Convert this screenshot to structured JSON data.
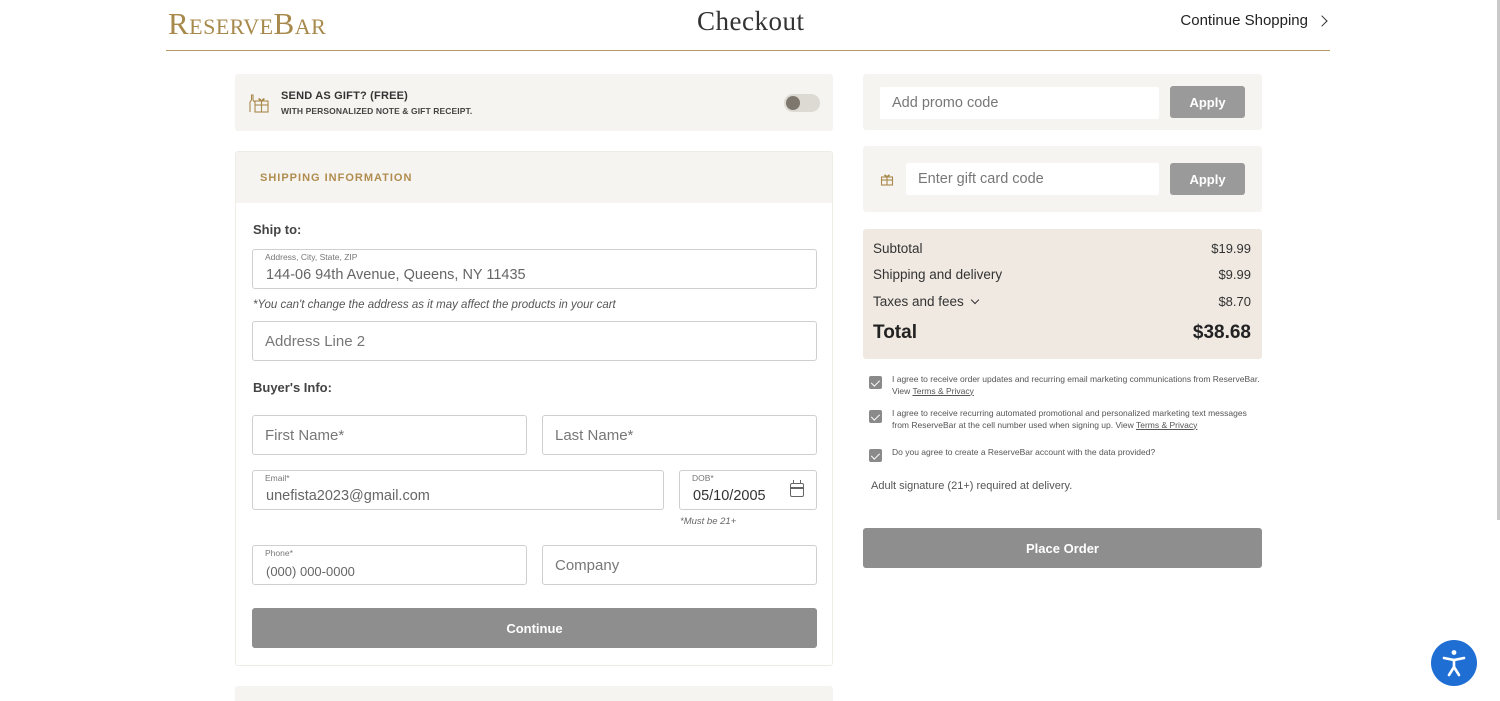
{
  "header": {
    "logo": "ReserveBar",
    "title": "Checkout",
    "continue_shopping": "Continue Shopping"
  },
  "gift": {
    "title": "SEND AS GIFT? (FREE)",
    "subtitle": "WITH PERSONALIZED NOTE & GIFT RECEIPT.",
    "enabled": false
  },
  "shipping": {
    "section_title": "SHIPPING INFORMATION",
    "ship_to_label": "Ship to:",
    "address_label": "Address, City, State, ZIP",
    "address_value": "144-06 94th Avenue, Queens, NY 11435",
    "address_note": "*You can't change the address as it may affect the products in your cart",
    "address2_placeholder": "Address Line 2",
    "buyer_label": "Buyer's Info:",
    "first_name_placeholder": "First Name*",
    "last_name_placeholder": "Last Name*",
    "email_label": "Email*",
    "email_value": "unefista2023@gmail.com",
    "dob_label": "DOB*",
    "dob_value": "05/10/2005",
    "dob_note": "*Must be 21+",
    "phone_label": "Phone*",
    "phone_value": "(000) 000-0000",
    "company_placeholder": "Company",
    "continue_button": "Continue"
  },
  "promo": {
    "placeholder": "Add promo code",
    "apply_label": "Apply"
  },
  "gift_card": {
    "placeholder": "Enter gift card code",
    "apply_label": "Apply"
  },
  "summary": {
    "subtotal_label": "Subtotal",
    "subtotal_value": "$19.99",
    "shipping_label": "Shipping and delivery",
    "shipping_value": "$9.99",
    "taxes_label": "Taxes and fees",
    "taxes_value": "$8.70",
    "total_label": "Total",
    "total_value": "$38.68"
  },
  "consents": {
    "c1_text": "I agree to receive order updates and recurring email marketing communications from ReserveBar. View ",
    "c1_link": "Terms & Privacy",
    "c2_text": "I agree to receive recurring automated promotional and personalized marketing text messages from ReserveBar at the cell number used when signing up. View ",
    "c2_link": "Terms & Privacy",
    "c3_text": "Do you agree to create a ReserveBar account with the data provided?"
  },
  "adult_note": "Adult signature (21+) required at delivery.",
  "place_order": "Place Order",
  "colors": {
    "gold": "#a8894c",
    "panel_bg": "#f6f4f0",
    "summary_bg": "#efe9e1",
    "button_gray": "#8e8e8e",
    "a11y_blue": "#1f6ed4"
  }
}
